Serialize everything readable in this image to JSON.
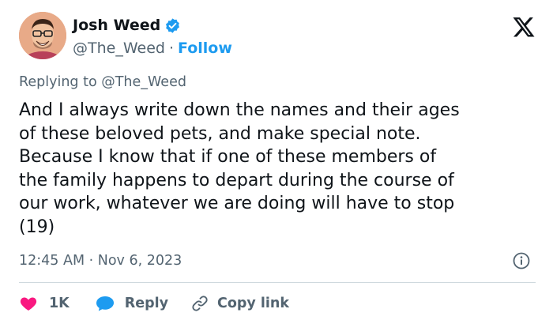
{
  "author": {
    "display_name": "Josh Weed",
    "handle": "@The_Weed",
    "separator": "·",
    "follow_label": "Follow"
  },
  "reply_context": {
    "prefix": "Replying to ",
    "handle": "@The_Weed"
  },
  "tweet": {
    "text": "And I always write down the names and their ages\nof these beloved pets, and make special note.\nBecause I know that if one of these members of\nthe family happens to depart during the course of\nour work, whatever we are doing will have to stop\n(19)",
    "timestamp": "12:45 AM · Nov 6, 2023"
  },
  "actions": {
    "like_count": "1K",
    "reply_label": "Reply",
    "copy_link_label": "Copy link"
  },
  "icons": {
    "verified": "verified-badge-icon",
    "platform": "x-logo-icon",
    "info": "info-icon",
    "like": "heart-icon",
    "reply": "speech-bubble-icon",
    "copy_link": "link-icon"
  },
  "colors": {
    "accent": "#1d9bf0",
    "like": "#f91880",
    "text": "#0f1419",
    "secondary": "#536471",
    "divider": "#cfd9de"
  }
}
